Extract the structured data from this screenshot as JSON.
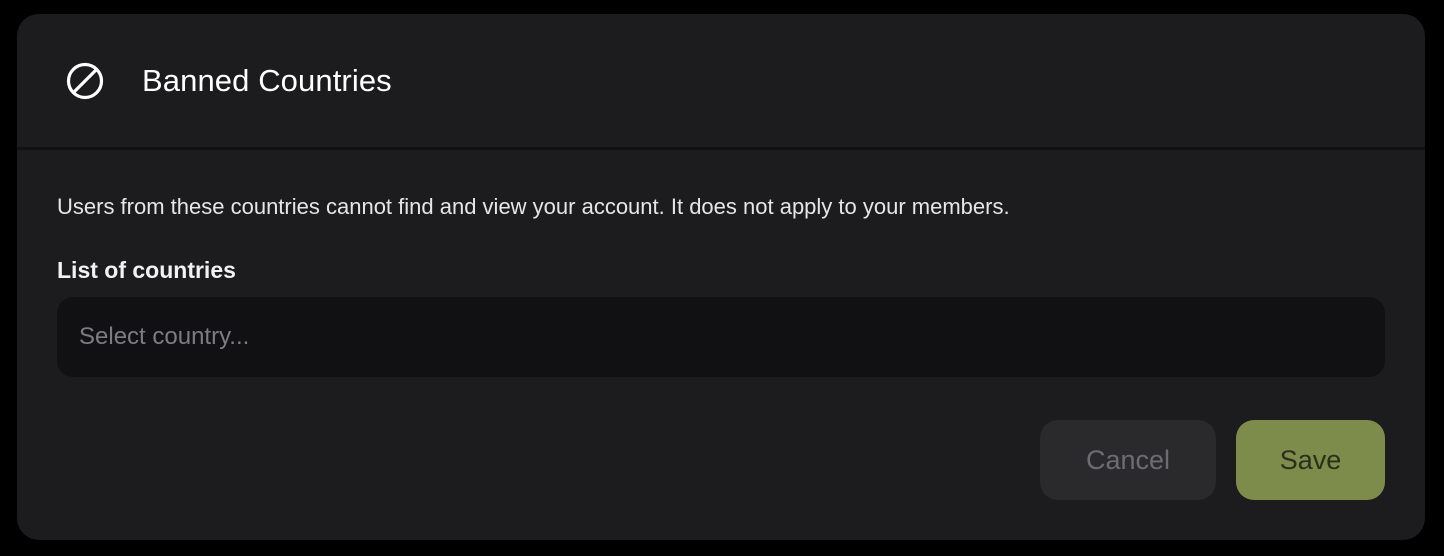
{
  "header": {
    "icon": "ban-icon",
    "title": "Banned Countries"
  },
  "body": {
    "description": "Users from these countries cannot find and view your account. It does not apply to your members.",
    "field_label": "List of countries",
    "select": {
      "placeholder": "Select country...",
      "value": ""
    }
  },
  "actions": {
    "cancel_label": "Cancel",
    "save_label": "Save"
  },
  "colors": {
    "background": "#000000",
    "card": "#1c1c1e",
    "input": "#111113",
    "cancel_button": "#2a2a2d",
    "save_button": "#7d8c4a"
  }
}
